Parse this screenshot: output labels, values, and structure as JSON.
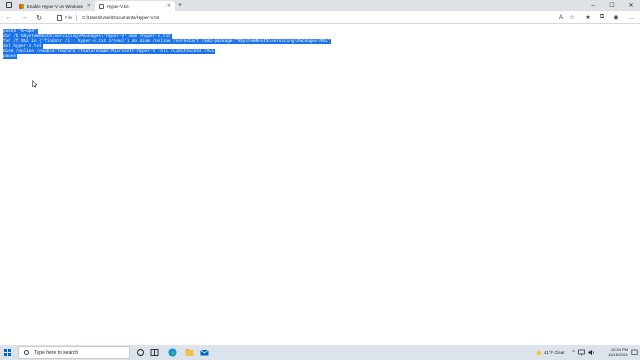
{
  "browser": {
    "tabs": [
      {
        "title": "Enable Hyper-V on Windows 10 | Mi",
        "active": false,
        "close_glyph": "✕",
        "favicon": "microsoft-logo-icon"
      },
      {
        "title": "Hyper-V.txt",
        "active": true,
        "close_glyph": "✕",
        "favicon": "document-icon"
      }
    ],
    "new_tab_glyph": "+",
    "window_controls": {
      "minimize": "–",
      "maximize": "☐",
      "close": "✕"
    },
    "nav": {
      "back": "←",
      "forward": "→",
      "refresh": "↻"
    },
    "address": {
      "scheme_label": "File",
      "url": "C:/Users/User/Documents/Hyper-V.txt"
    },
    "toolbar_icons": {
      "read_aloud": "A",
      "favorite": "☆",
      "favorites": "★",
      "collections": "⧉",
      "profile": "◉",
      "menu": "…"
    }
  },
  "document": {
    "lines": [
      "pushd \"%~dp0\"",
      "dir /b %SystemRoot%\\servicing\\Packages\\*Hyper-V*.mum >hyper-v.txt",
      "for /f %%i in ('findstr /i . hyper-v.txt 2^>nul') do dism /online /norestart /add-package:\"%SystemRoot%\\servicing\\Packages\\%%i\"",
      "del hyper-v.txt",
      "Dism /online /enable-feature /featurename:Microsoft-Hyper-V -All /LimitAccess /ALL",
      "pause"
    ],
    "selection_color": "#1a73e8"
  },
  "taskbar": {
    "search_placeholder": "Type here to search",
    "pinned": [
      "task-view-icon",
      "file-explorer-icon",
      "edge-icon",
      "store-icon",
      "mail-icon"
    ],
    "weather": "41°F  Clear",
    "time": "10:34 PM",
    "date": "10/15/2021"
  },
  "colors": {
    "tabbar_bg": "#dee1e6",
    "taskbar_bg": "#dde3ea",
    "accent": "#0067c0"
  }
}
